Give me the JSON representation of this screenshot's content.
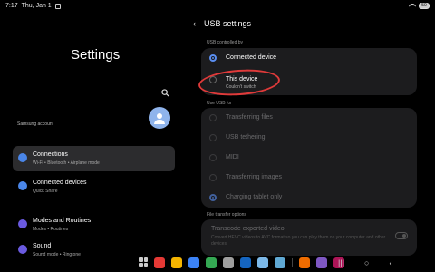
{
  "status_bar": {
    "time": "7:17",
    "date": "Thu, Jan 1",
    "battery": "50"
  },
  "settings": {
    "title": "Settings",
    "account_label": "Samsung account",
    "nav": [
      {
        "title": "Connections",
        "subtitle": "Wi-Fi • Bluetooth • Airplane mode"
      },
      {
        "title": "Connected devices",
        "subtitle": "Quick Share"
      },
      {
        "title": "Modes and Routines",
        "subtitle": "Modes • Routines"
      },
      {
        "title": "Sound",
        "subtitle": "Sound mode • Ringtone"
      }
    ]
  },
  "usb": {
    "title": "USB settings",
    "controlled_by_label": "USB controlled by",
    "controlled_by": [
      {
        "label": "Connected device",
        "selected": true
      },
      {
        "label": "This device",
        "sub": "Couldn't switch",
        "selected": false
      }
    ],
    "use_for_label": "Use USB for",
    "use_for": [
      {
        "label": "Transferring files"
      },
      {
        "label": "USB tethering"
      },
      {
        "label": "MIDI"
      },
      {
        "label": "Transferring images"
      },
      {
        "label": "Charging tablet only",
        "selected": true
      }
    ],
    "file_transfer_label": "File transfer options",
    "transcode": {
      "title": "Transcode exported video",
      "description": "Convert HEVC videos to AVC format so you can play them on your computer and other devices."
    }
  },
  "taskbar": {
    "app_colors": [
      "#e53935",
      "#f4b400",
      "#3b82f6",
      "#34a853",
      "#9e9e9e",
      "#1565c0",
      "#7cb8e8",
      "#5fa8d3",
      "#ef6c00",
      "#7e57c2",
      "#ad1457"
    ],
    "nav_buttons": [
      "|||",
      "○",
      "‹"
    ]
  },
  "colors": {
    "accent": "#5a8ef0",
    "annotation": "#e03a3a"
  }
}
